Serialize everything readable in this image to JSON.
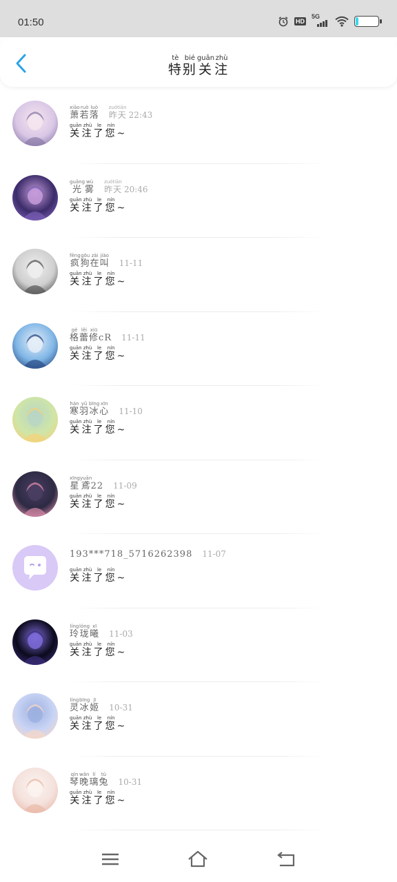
{
  "status_bar": {
    "time": "01:50",
    "hd": "HD",
    "network": "5G"
  },
  "header": {
    "title": [
      {
        "char": "特",
        "py": "tè"
      },
      {
        "char": "别",
        "py": "bié"
      },
      {
        "char": "关",
        "py": "guān"
      },
      {
        "char": "注",
        "py": "zhù"
      }
    ]
  },
  "message_template": [
    {
      "char": "关",
      "py": "guān"
    },
    {
      "char": "注",
      "py": "zhù"
    },
    {
      "char": "了",
      "py": "le"
    },
    {
      "char": "您",
      "py": "nín"
    },
    {
      "char": "~",
      "py": ""
    }
  ],
  "items": [
    {
      "name": [
        {
          "char": "萧",
          "py": "xiāo"
        },
        {
          "char": "若",
          "py": "ruò"
        },
        {
          "char": "落",
          "py": "luò"
        }
      ],
      "time": [
        {
          "char": "昨",
          "py": "zuó"
        },
        {
          "char": "天",
          "py": "tiān"
        },
        {
          "char": " 22:43",
          "py": ""
        }
      ],
      "avatar_colors": [
        "#d9c7e6",
        "#8a7aa8",
        "#f4e6ee"
      ]
    },
    {
      "name": [
        {
          "char": "光",
          "py": "guāng"
        },
        {
          "char": "雾",
          "py": "wù"
        }
      ],
      "time": [
        {
          "char": "昨",
          "py": "zuó"
        },
        {
          "char": "天",
          "py": "tiān"
        },
        {
          "char": " 20:46",
          "py": ""
        }
      ],
      "avatar_colors": [
        "#3c2c6a",
        "#7b5fb8",
        "#c59bd9"
      ]
    },
    {
      "name": [
        {
          "char": "疯",
          "py": "fēng"
        },
        {
          "char": "狗",
          "py": "gǒu"
        },
        {
          "char": "在",
          "py": "zài"
        },
        {
          "char": "叫",
          "py": "jiào"
        }
      ],
      "time": [
        {
          "char": "11-11",
          "py": ""
        }
      ],
      "avatar_colors": [
        "#cfcfcf",
        "#555555",
        "#efefef"
      ]
    },
    {
      "name": [
        {
          "char": "格",
          "py": "gé"
        },
        {
          "char": "蕾",
          "py": "lěi"
        },
        {
          "char": "修",
          "py": "xiū"
        },
        {
          "char": "cR",
          "py": ""
        }
      ],
      "time": [
        {
          "char": "11-11",
          "py": ""
        }
      ],
      "avatar_colors": [
        "#7fb6e6",
        "#2b4c87",
        "#e6eef8"
      ]
    },
    {
      "name": [
        {
          "char": "寒",
          "py": "hán"
        },
        {
          "char": "羽",
          "py": "yǔ"
        },
        {
          "char": "冰",
          "py": "bīng"
        },
        {
          "char": "心",
          "py": "xīn"
        }
      ],
      "time": [
        {
          "char": "11-10",
          "py": ""
        }
      ],
      "avatar_colors": [
        "#cfe5a8",
        "#f3d37a",
        "#b8d6c4"
      ]
    },
    {
      "name": [
        {
          "char": "星",
          "py": "xīng"
        },
        {
          "char": "鳶",
          "py": "yuān"
        },
        {
          "char": "22",
          "py": ""
        }
      ],
      "time": [
        {
          "char": "11-09",
          "py": ""
        }
      ],
      "avatar_colors": [
        "#2d2a44",
        "#d98aa8",
        "#4a3e62"
      ]
    },
    {
      "name": [
        {
          "char": "193***718_5716262398",
          "py": ""
        }
      ],
      "time": [
        {
          "char": "11-07",
          "py": ""
        }
      ],
      "avatar_colors": [
        "#d9c9f7",
        "#ffffff",
        "#b6a1e6"
      ]
    },
    {
      "name": [
        {
          "char": "玲",
          "py": "líng"
        },
        {
          "char": "珑",
          "py": "lóng"
        },
        {
          "char": "曦",
          "py": "xī"
        }
      ],
      "time": [
        {
          "char": "11-03",
          "py": ""
        }
      ],
      "avatar_colors": [
        "#0b0a1c",
        "#3c2e7a",
        "#7d6bd8"
      ]
    },
    {
      "name": [
        {
          "char": "灵",
          "py": "líng"
        },
        {
          "char": "冰",
          "py": "bīng"
        },
        {
          "char": "姬",
          "py": "jī"
        }
      ],
      "time": [
        {
          "char": "10-31",
          "py": ""
        }
      ],
      "avatar_colors": [
        "#c9d4f5",
        "#f5d7c8",
        "#9cb0e0"
      ]
    },
    {
      "name": [
        {
          "char": "琴",
          "py": "qín"
        },
        {
          "char": "晚",
          "py": "wǎn"
        },
        {
          "char": "璃",
          "py": "lí"
        },
        {
          "char": "兔",
          "py": "tù"
        }
      ],
      "time": [
        {
          "char": "10-31",
          "py": ""
        }
      ],
      "avatar_colors": [
        "#f4e1dc",
        "#e9b9a8",
        "#fbf3ef"
      ]
    }
  ],
  "theme": {
    "accent": "#2ba3e8"
  }
}
